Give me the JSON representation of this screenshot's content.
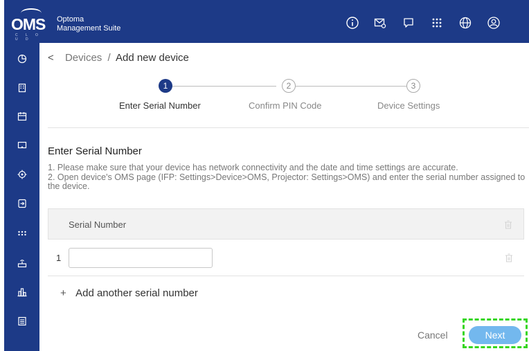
{
  "app": {
    "brand_logo": "OMS",
    "brand_sub": "C L O U D",
    "title_line1": "Optoma",
    "title_line2": "Management Suite",
    "header_color": "#1d3a87"
  },
  "top_icons": [
    "info-icon",
    "mail-icon",
    "chat-icon",
    "apps-grid-icon",
    "globe-icon",
    "user-icon"
  ],
  "sidebar": [
    "dashboard-icon",
    "building-icon",
    "calendar-icon",
    "display-icon",
    "target-icon",
    "transfer-icon",
    "dots-icon",
    "router-icon",
    "chart-icon",
    "list-icon"
  ],
  "breadcrumb": {
    "back": "<",
    "parent": "Devices",
    "separator": "/",
    "current": "Add new device"
  },
  "steps": [
    {
      "num": "1",
      "label": "Enter Serial Number",
      "state": "active"
    },
    {
      "num": "2",
      "label": "Confirm PIN Code",
      "state": "todo"
    },
    {
      "num": "3",
      "label": "Device Settings",
      "state": "todo"
    }
  ],
  "section": {
    "title": "Enter Serial Number",
    "line1": "1. Please make sure that your device has network connectivity and the date and time settings are accurate.",
    "line2": "2. Open device's OMS page (IFP: Settings>Device>OMS, Projector: Settings>OMS) and enter the serial number assigned to the device."
  },
  "table": {
    "header": "Serial Number",
    "rows": [
      {
        "index": "1",
        "value": ""
      }
    ]
  },
  "add_link": {
    "plus": "+",
    "label": "Add another serial number"
  },
  "actions": {
    "cancel": "Cancel",
    "next": "Next",
    "next_color": "#73b8ee",
    "highlight_color": "#36d61f"
  }
}
